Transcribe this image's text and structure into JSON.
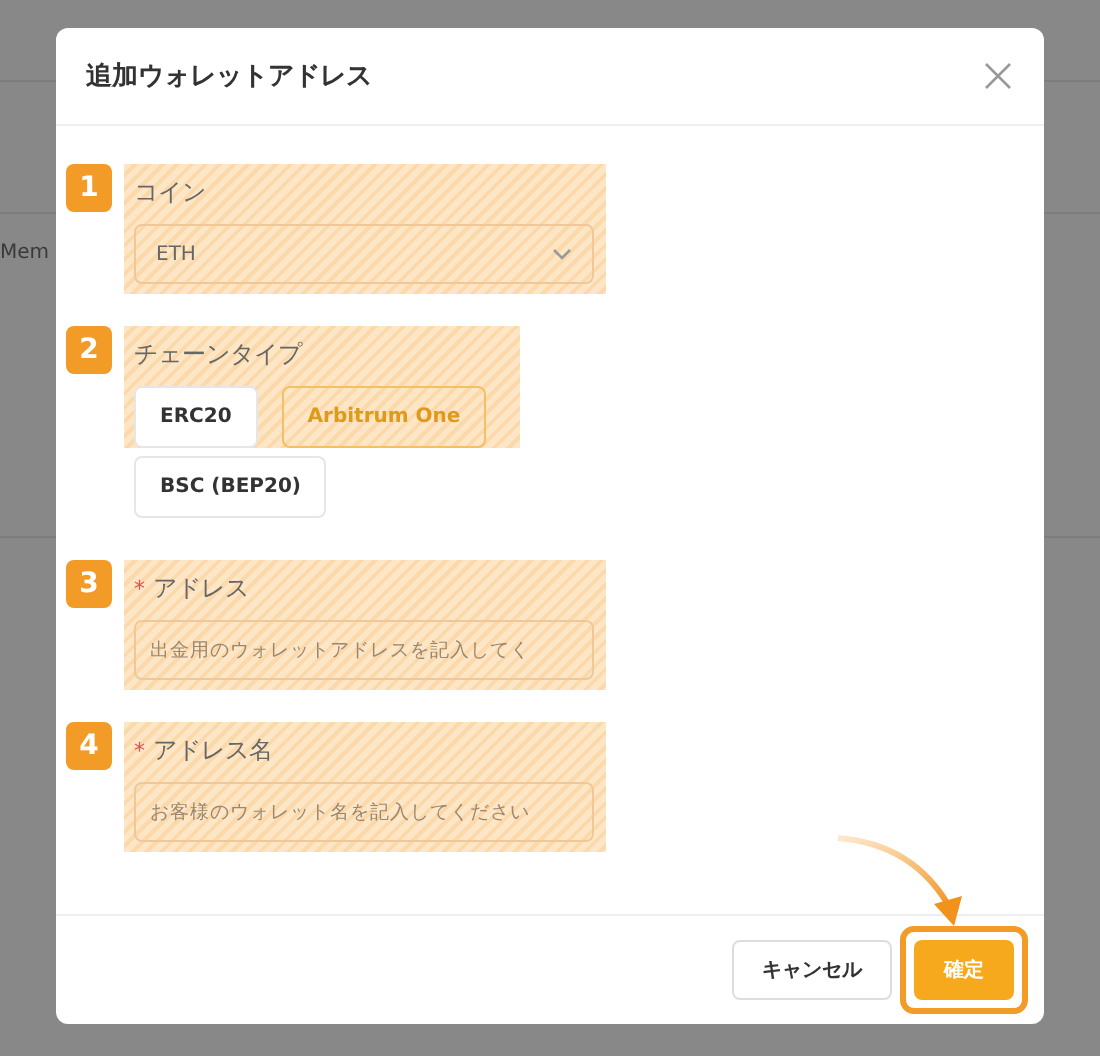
{
  "background": {
    "label": "Mem"
  },
  "dialog": {
    "title": "追加ウォレットアドレス"
  },
  "steps": [
    {
      "number": "1",
      "kind": "select",
      "label": "コイン",
      "value": "ETH"
    },
    {
      "number": "2",
      "kind": "chains",
      "label": "チェーンタイプ",
      "options": [
        {
          "label": "ERC20",
          "selected": false
        },
        {
          "label": "Arbitrum One",
          "selected": true
        },
        {
          "label": "BSC (BEP20)",
          "selected": false
        }
      ]
    },
    {
      "number": "3",
      "kind": "input",
      "label": "アドレス",
      "mark": "*",
      "placeholder": "出金用のウォレットアドレスを記入してく"
    },
    {
      "number": "4",
      "kind": "input",
      "label": "アドレス名",
      "mark": "*",
      "placeholder": "お客様のウォレット名を記入してください"
    }
  ],
  "buttons": [
    {
      "label": "キャンセル",
      "kind": "secondary",
      "highlighted": false
    },
    {
      "label": "確定",
      "kind": "primary",
      "highlighted": true
    }
  ]
}
